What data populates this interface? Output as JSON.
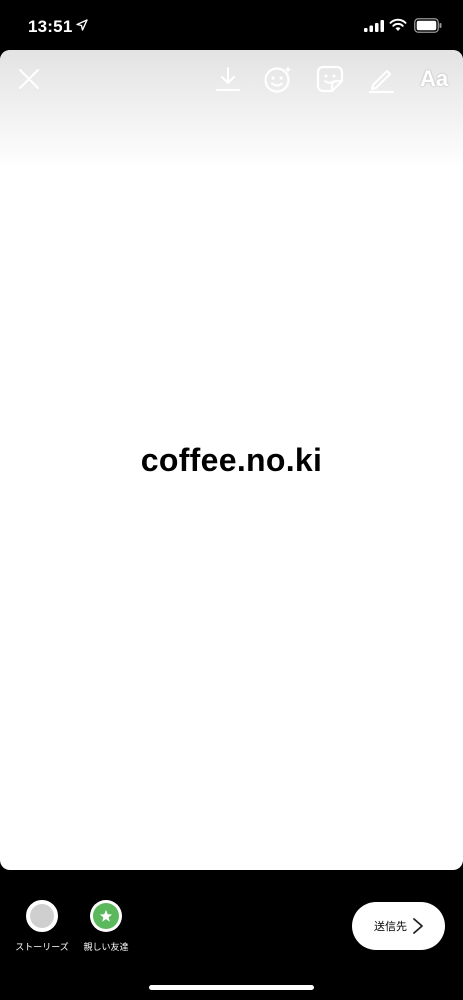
{
  "status_bar": {
    "time": "13:51",
    "icons": [
      "location-arrow-icon",
      "cellular-signal-icon",
      "wifi-icon",
      "battery-icon"
    ]
  },
  "toolbar": {
    "close_icon": "close-icon",
    "download_icon": "download-icon",
    "face_effects_icon": "face-effects-icon",
    "sticker_icon": "sticker-icon",
    "draw_icon": "pen-icon",
    "text_label": "Aa"
  },
  "story": {
    "text": "coffee.no.ki",
    "background": "#ffffff",
    "text_color": "#000000"
  },
  "share": {
    "options": [
      {
        "label": "ストーリーズ",
        "icon": "stories-avatar-icon"
      },
      {
        "label": "親しい友達",
        "icon": "close-friends-star-icon",
        "color": "#5cb85c"
      }
    ],
    "send_label": "送信先",
    "send_icon": "chevron-right-icon"
  }
}
